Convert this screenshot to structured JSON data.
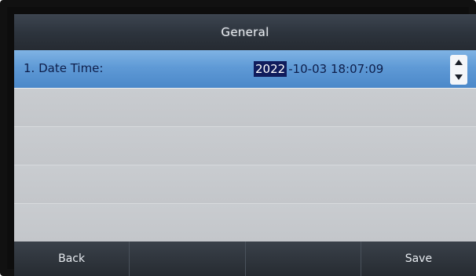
{
  "title": "General",
  "rows": [
    {
      "label": "1. Date Time:",
      "value_selected": "2022",
      "value_rest": "-10-03 18:07:09"
    }
  ],
  "softkeys": [
    "Back",
    "",
    "",
    "Save"
  ],
  "colors": {
    "title_bar": "#2c333c",
    "selected_row": "#5f9ad6",
    "value_highlight": "#101c5c"
  }
}
